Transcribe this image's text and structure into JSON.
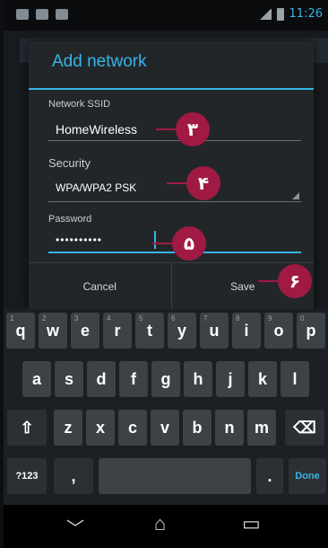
{
  "status_bar": {
    "time": "11:26"
  },
  "dialog": {
    "title": "Add network",
    "ssid": {
      "label": "Network SSID",
      "value": "HomeWireless"
    },
    "security": {
      "label": "Security",
      "value": "WPA/WPA2 PSK"
    },
    "password": {
      "label": "Password",
      "value": "••••••••••"
    },
    "buttons": {
      "cancel": "Cancel",
      "save": "Save"
    }
  },
  "callouts": [
    "۳",
    "۴",
    "۵",
    "۶"
  ],
  "keyboard": {
    "row1": [
      {
        "k": "q",
        "h": "1"
      },
      {
        "k": "w",
        "h": "2"
      },
      {
        "k": "e",
        "h": "3"
      },
      {
        "k": "r",
        "h": "4"
      },
      {
        "k": "t",
        "h": "5"
      },
      {
        "k": "y",
        "h": "6"
      },
      {
        "k": "u",
        "h": "7"
      },
      {
        "k": "i",
        "h": "8"
      },
      {
        "k": "o",
        "h": "9"
      },
      {
        "k": "p",
        "h": "0"
      }
    ],
    "row2": [
      "a",
      "s",
      "d",
      "f",
      "g",
      "h",
      "j",
      "k",
      "l"
    ],
    "row3": [
      "z",
      "x",
      "c",
      "v",
      "b",
      "n",
      "m"
    ],
    "row4": {
      "symbols": "?123",
      "comma": ",",
      "period": ".",
      "done": "Done"
    },
    "shift_glyph": "⇧",
    "delete_glyph": "⌫"
  },
  "nav": {
    "back": "﹀",
    "home": "⌂",
    "recents": "▭"
  }
}
